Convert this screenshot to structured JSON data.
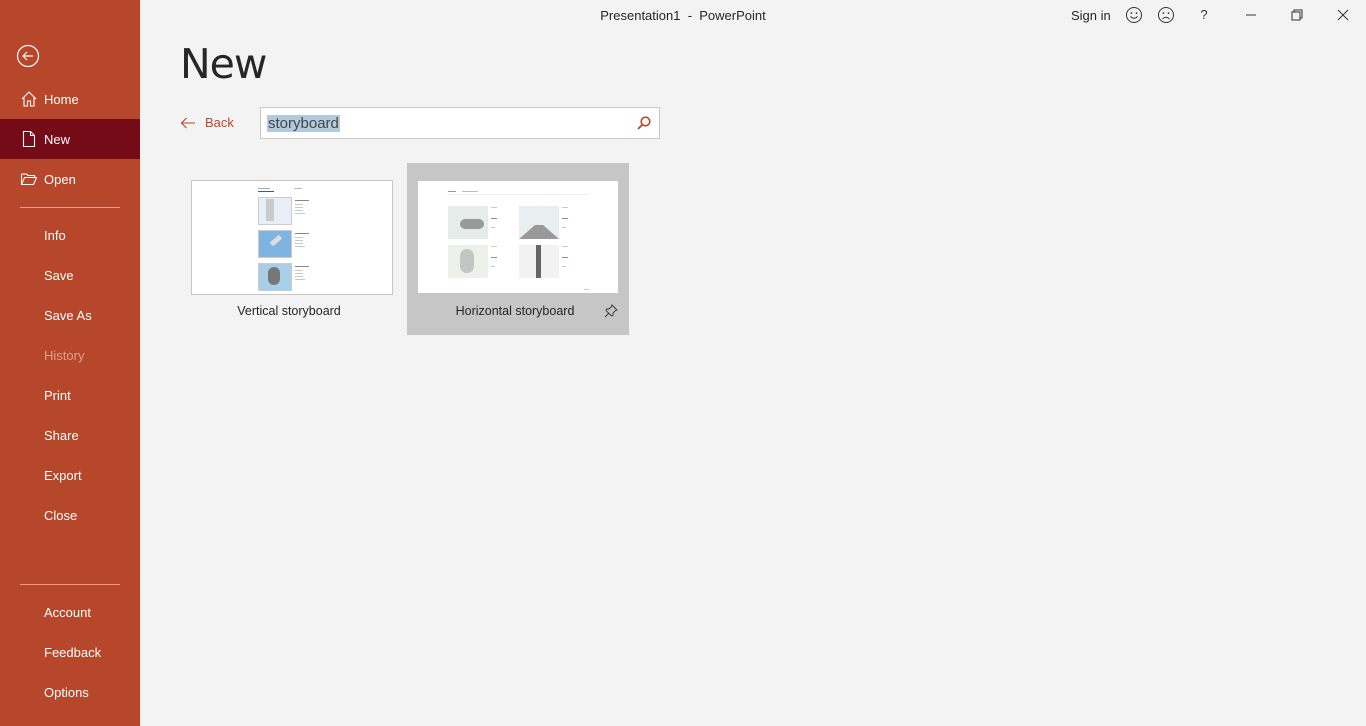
{
  "window": {
    "title": "Presentation1  -  PowerPoint",
    "sign_in": "Sign in",
    "icons": [
      "smile-icon",
      "frown-icon",
      "help-icon",
      "minimize-icon",
      "restore-icon",
      "close-icon"
    ],
    "help_label": "?"
  },
  "sidebar": {
    "back_icon": "back-arrow-circle-icon",
    "items": [
      {
        "label": "Home",
        "icon": "home-icon"
      },
      {
        "label": "New",
        "icon": "new-document-icon",
        "selected": true
      },
      {
        "label": "Open",
        "icon": "open-folder-icon"
      },
      {
        "label": "Info"
      },
      {
        "label": "Save"
      },
      {
        "label": "Save As"
      },
      {
        "label": "History",
        "disabled": true
      },
      {
        "label": "Print"
      },
      {
        "label": "Share"
      },
      {
        "label": "Export"
      },
      {
        "label": "Close"
      },
      {
        "label": "Account"
      },
      {
        "label": "Feedback"
      },
      {
        "label": "Options"
      }
    ]
  },
  "main": {
    "title": "New",
    "back_label": "Back",
    "search": {
      "value": "storyboard",
      "placeholder": "Search for online templates and themes"
    },
    "templates": [
      {
        "label": "Vertical storyboard",
        "hovered": false
      },
      {
        "label": "Horizontal storyboard",
        "hovered": true,
        "pin_icon": "pin-icon"
      }
    ]
  },
  "colors": {
    "accent": "#b7472a",
    "selected": "#750b17",
    "background": "#f3f3f3",
    "selection_highlight": "#b3c9de"
  }
}
